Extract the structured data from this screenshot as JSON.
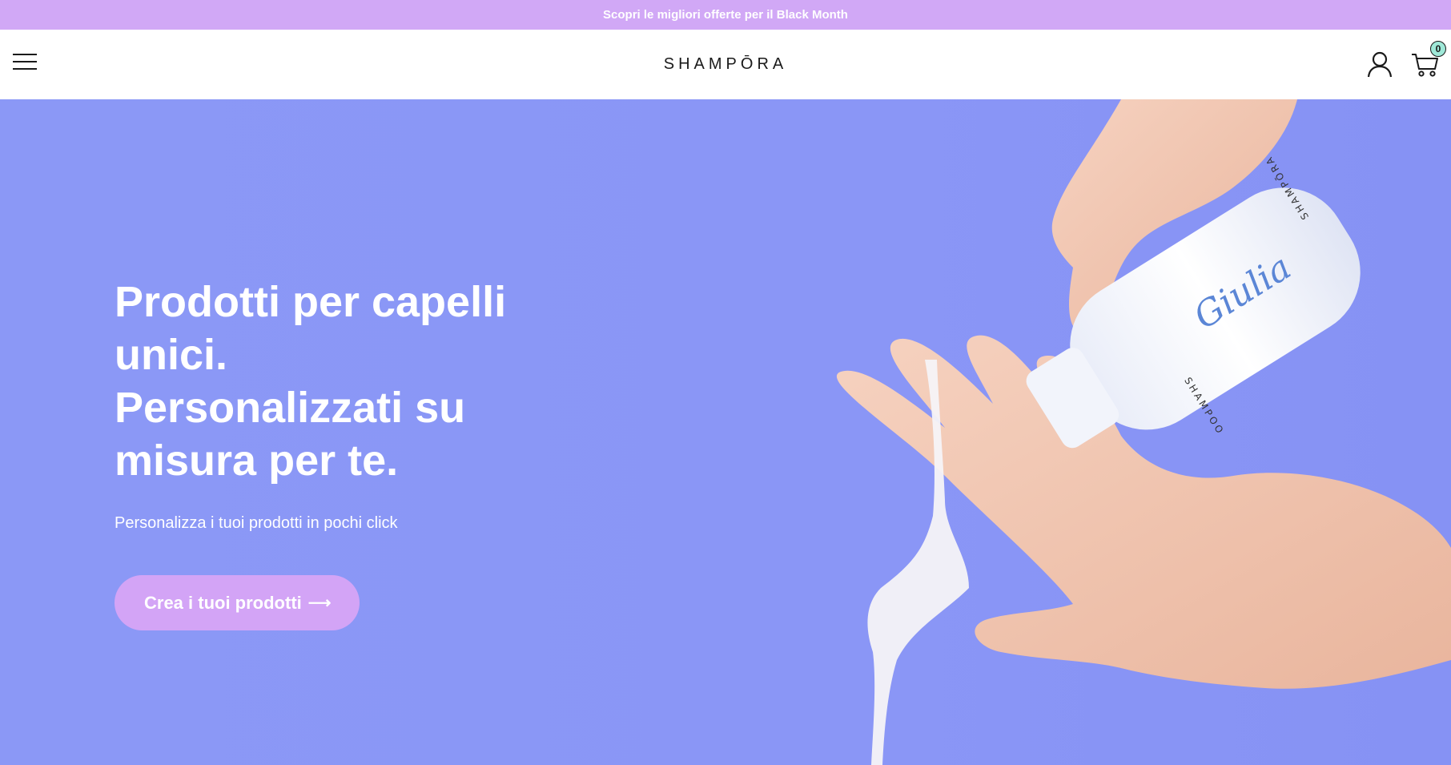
{
  "announcement": {
    "text": "Scopri le migliori offerte per il Black Month"
  },
  "header": {
    "logo": "SHAMPŌRA",
    "menu_icon": "hamburger-menu-icon",
    "account_icon": "user-icon",
    "cart_icon": "shopping-cart-icon",
    "cart_count": "0"
  },
  "hero": {
    "title_lines": [
      "Prodotti per capelli",
      "unici.",
      "Personalizzati su",
      "misura per te."
    ],
    "subtitle": "Personalizza i tuoi prodotti in pochi click",
    "cta_label": "Crea i tuoi prodotti",
    "cta_arrow": "⟶",
    "bottle_label_script": "Giulia",
    "bottle_label_product": "SHAMPOO",
    "bottle_label_brand": "SHAMPŌRA"
  },
  "colors": {
    "announcement_bg": "#d1a8f6",
    "hero_bg": "#8a96f6",
    "cta_bg": "#d3a4f6",
    "badge_bg": "#9fe8d8"
  }
}
